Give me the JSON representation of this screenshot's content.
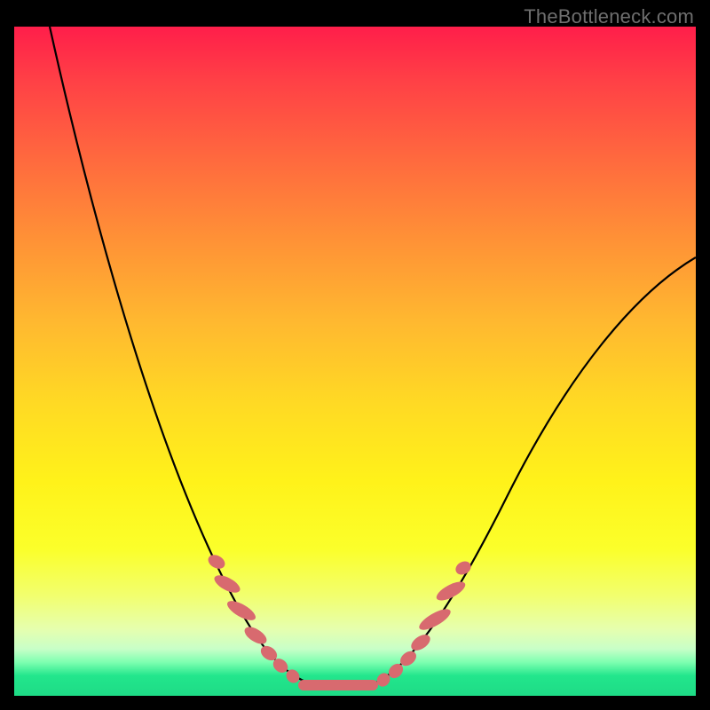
{
  "watermark": "TheBottleneck.com",
  "colors": {
    "background": "#000000",
    "curve": "#000000",
    "bead": "#d86a6f",
    "gradient_top": "#ff1e4a",
    "gradient_bottom": "#1edb86"
  },
  "chart_data": {
    "type": "line",
    "title": "",
    "xlabel": "",
    "ylabel": "",
    "xlim": [
      0,
      100
    ],
    "ylim": [
      0,
      100
    ],
    "note": "Axes are not labeled in the source image; x/y are normalized 0–100. y represents bottleneck percentage (0 at bottom/green, 100 at top/red). The curve dips to ~0 around x≈45 and rises on both sides.",
    "series": [
      {
        "name": "bottleneck-curve",
        "x": [
          0,
          5,
          10,
          15,
          20,
          25,
          30,
          35,
          40,
          45,
          48,
          52,
          55,
          60,
          65,
          70,
          75,
          80,
          85,
          90,
          95,
          100
        ],
        "y": [
          100,
          92,
          83,
          73,
          62,
          50,
          37,
          23,
          10,
          2,
          0,
          0,
          2,
          8,
          17,
          27,
          36,
          45,
          53,
          59,
          63,
          66
        ]
      }
    ],
    "markers": {
      "left_cluster": {
        "x_range": [
          27,
          42
        ],
        "note": "dotted red beads along descending arm near bottom"
      },
      "right_cluster": {
        "x_range": [
          52,
          62
        ],
        "note": "dotted red beads along ascending arm near bottom"
      },
      "flat_segment": {
        "x_range": [
          42,
          52
        ],
        "note": "thick red segment along the minimum"
      }
    }
  }
}
